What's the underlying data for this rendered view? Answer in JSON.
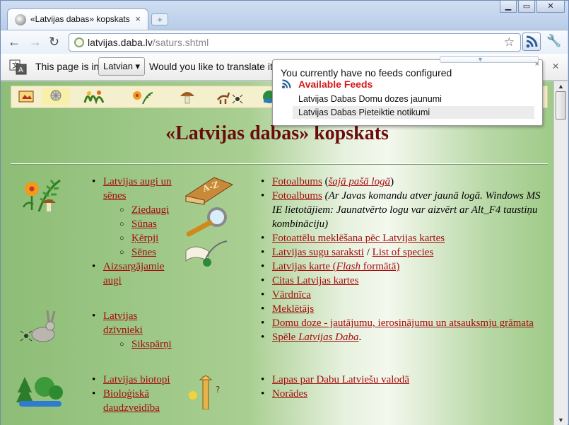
{
  "browser": {
    "tab_title": "«Latvijas dabas» kopskats",
    "tab_close": "×",
    "new_tab": "+",
    "window_buttons": [
      "▁",
      "▭",
      "✕"
    ],
    "url_host": "latvijas.daba.lv",
    "url_path": "/saturs.shtml",
    "star": "☆",
    "wrench": "🔧",
    "back": "←",
    "forward": "→",
    "reload": "↻"
  },
  "infobar": {
    "text_before": "This page is in",
    "language": "Latvian ▾",
    "text_after": "Would you like to translate it?",
    "close": "×"
  },
  "feeds_popup": {
    "no_feeds": "You currently have no feeds configured",
    "available": "Available Feeds",
    "close": "×",
    "feeds": [
      "Latvijas Dabas Domu dozes jaunumi",
      "Latvijas Dabas Pieteiktie notikumi"
    ]
  },
  "page": {
    "title": "«Latvijas dabas» kopskats",
    "col1_group1": {
      "item": "Latvijas augi un sēnes",
      "sub": [
        "Ziedaugi",
        "Sūnas",
        "Ķērpji",
        "Sēnes"
      ],
      "item2": "Aizsargājamie augi"
    },
    "col1_group2": {
      "item": "Latvijas dzīvnieki",
      "sub": [
        "Sikspārņi"
      ]
    },
    "col1_group3": {
      "items": [
        "Latvijas biotopi",
        "Bioloģiskā daudzveidība"
      ]
    },
    "col2": {
      "fotoalbums1": "Fotoalbums",
      "fotoalbums1_paren_open": " (",
      "fotoalbums1_link": "šajā pašā logā",
      "fotoalbums1_paren_close": ")",
      "fotoalbums2": "Fotoalbums",
      "fotoalbums2_note": "(Ar Javas komandu atver jaunā logā. Windows MS IE lietotājiem: Jaunatvērto logu var aizvērt ar Alt_F4 taustiņu kombināciju)",
      "map_search": "Fotoattēlu meklēšana pēc Latvijas kartes",
      "species_lv": "Latvijas sugu saraksti",
      "sep": " / ",
      "species_en": "List of species",
      "map_pre": "Latvijas karte (",
      "map_flash": "Flash",
      "map_post": " formātā)",
      "other_maps": "Citas Latvijas kartes",
      "dictionary": "Vārdnīca",
      "search": "Meklētājs",
      "dose": "Domu doze - jautājumu, ierosinājumu un atsauksmju grāmata",
      "game_pre": "Spēle ",
      "game_name": "Latvijas Daba",
      "game_dot": "."
    },
    "col2b": {
      "pages": "Lapas par Dabu Latviešu valodā",
      "notes": "Norādes"
    }
  }
}
